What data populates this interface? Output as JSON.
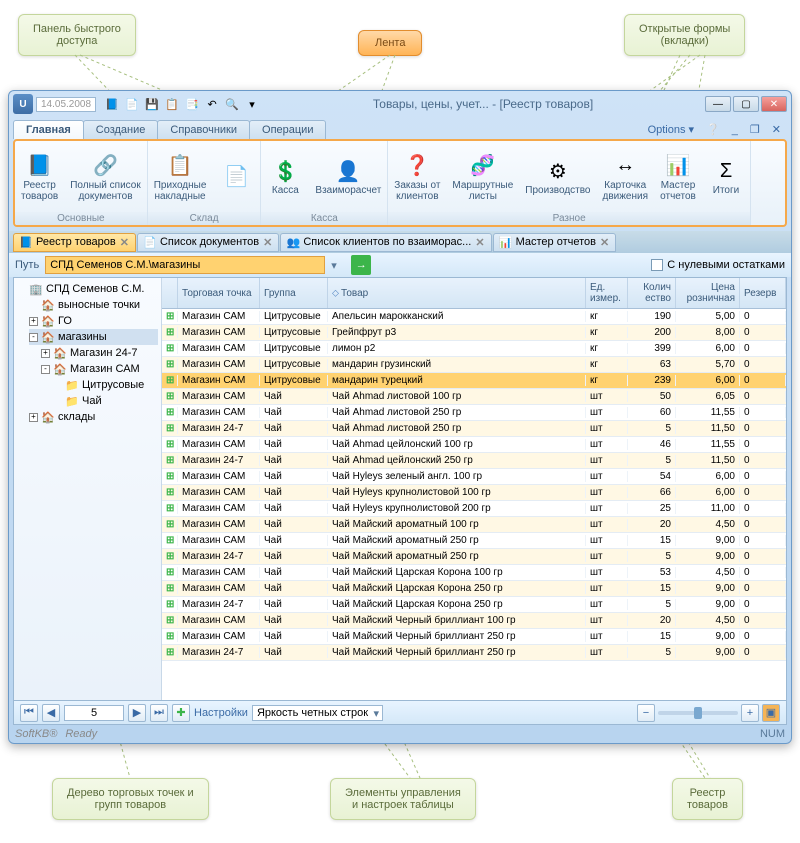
{
  "callouts": {
    "qat": "Панель быстрого\nдоступа",
    "ribbon": "Лента",
    "tabs": "Открытые формы\n(вкладки)",
    "tree": "Дерево торговых точек и\nгрупп товаров",
    "controls": "Элементы управления\nи настроек таблицы",
    "registry": "Реестр\nтоваров"
  },
  "window": {
    "date": "14.05.2008",
    "title": "Товары, цены, учет... - [Реестр товаров]",
    "options": "Options"
  },
  "ribbonTabs": [
    "Главная",
    "Создание",
    "Справочники",
    "Операции"
  ],
  "ribbon": {
    "groups": [
      {
        "label": "Основные",
        "items": [
          {
            "icon": "📘",
            "label": "Реестр\nтоваров"
          },
          {
            "icon": "🔗",
            "label": "Полный список\nдокументов"
          }
        ]
      },
      {
        "label": "Склад",
        "items": [
          {
            "icon": "📋",
            "label": "Приходные\nнакладные"
          },
          {
            "icon": "📄",
            "label": ""
          }
        ]
      },
      {
        "label": "Касса",
        "items": [
          {
            "icon": "💲",
            "label": "Касса"
          },
          {
            "icon": "👤",
            "label": "Взаиморасчет"
          }
        ]
      },
      {
        "label": "Разное",
        "items": [
          {
            "icon": "❓",
            "label": "Заказы от\nклиентов"
          },
          {
            "icon": "🧬",
            "label": "Маршрутные\nлисты"
          },
          {
            "icon": "⚙",
            "label": "Производство"
          },
          {
            "icon": "↔",
            "label": "Карточка\nдвижения"
          },
          {
            "icon": "📊",
            "label": "Мастер\nотчетов"
          },
          {
            "icon": "Σ",
            "label": "Итоги"
          }
        ]
      }
    ]
  },
  "docTabs": [
    {
      "icon": "📘",
      "label": "Реестр товаров",
      "active": true
    },
    {
      "icon": "📄",
      "label": "Список документов",
      "active": false
    },
    {
      "icon": "👥",
      "label": "Список клиентов по взаиморас...",
      "active": false
    },
    {
      "icon": "📊",
      "label": "Мастер отчетов",
      "active": false
    }
  ],
  "pathBar": {
    "label": "Путь",
    "value": "СПД Семенов С.М.\\магазины",
    "checkbox": "С нулевыми остатками"
  },
  "tree": [
    {
      "lvl": 0,
      "exp": "none",
      "icon": "🏢",
      "label": "СПД Семенов С.М."
    },
    {
      "lvl": 1,
      "exp": "none",
      "icon": "🏠",
      "label": "выносные точки"
    },
    {
      "lvl": 1,
      "exp": "+",
      "icon": "🏠",
      "label": "ГО"
    },
    {
      "lvl": 1,
      "exp": "-",
      "icon": "🏠",
      "label": "магазины",
      "sel": true
    },
    {
      "lvl": 2,
      "exp": "+",
      "icon": "🏠",
      "label": "Магазин 24-7"
    },
    {
      "lvl": 2,
      "exp": "-",
      "icon": "🏠",
      "label": "Магазин САМ"
    },
    {
      "lvl": 3,
      "exp": "none",
      "icon": "📁",
      "label": "Цитрусовые"
    },
    {
      "lvl": 3,
      "exp": "none",
      "icon": "📁",
      "label": "Чай"
    },
    {
      "lvl": 1,
      "exp": "+",
      "icon": "🏠",
      "label": "склады"
    }
  ],
  "columns": [
    "",
    "Торговая точка",
    "Группа",
    "Товар",
    "Ед. измер.",
    "Колич ество",
    "Цена розничная",
    "Резерв"
  ],
  "rows": [
    [
      "Магазин САМ",
      "Цитрусовые",
      "Апельсин марокканский",
      "кг",
      "190",
      "5,00",
      "0"
    ],
    [
      "Магазин САМ",
      "Цитрусовые",
      "Грейпфрут р3",
      "кг",
      "200",
      "8,00",
      "0"
    ],
    [
      "Магазин САМ",
      "Цитрусовые",
      "лимон р2",
      "кг",
      "399",
      "6,00",
      "0"
    ],
    [
      "Магазин САМ",
      "Цитрусовые",
      "мандарин грузинский",
      "кг",
      "63",
      "5,70",
      "0"
    ],
    [
      "Магазин САМ",
      "Цитрусовые",
      "мандарин турецкий",
      "кг",
      "239",
      "6,00",
      "0"
    ],
    [
      "Магазин САМ",
      "Чай",
      "Чай Ahmad листовой 100 гр",
      "шт",
      "50",
      "6,05",
      "0"
    ],
    [
      "Магазин САМ",
      "Чай",
      "Чай Ahmad листовой 250 гр",
      "шт",
      "60",
      "11,55",
      "0"
    ],
    [
      "Магазин 24-7",
      "Чай",
      "Чай Ahmad листовой 250 гр",
      "шт",
      "5",
      "11,50",
      "0"
    ],
    [
      "Магазин САМ",
      "Чай",
      "Чай Ahmad цейлонский 100 гр",
      "шт",
      "46",
      "11,55",
      "0"
    ],
    [
      "Магазин 24-7",
      "Чай",
      "Чай Ahmad цейлонский 250 гр",
      "шт",
      "5",
      "11,50",
      "0"
    ],
    [
      "Магазин САМ",
      "Чай",
      "Чай Hyleys зеленый англ. 100 гр",
      "шт",
      "54",
      "6,00",
      "0"
    ],
    [
      "Магазин САМ",
      "Чай",
      "Чай Hyleys крупнолистовой 100 гр",
      "шт",
      "66",
      "6,00",
      "0"
    ],
    [
      "Магазин САМ",
      "Чай",
      "Чай Hyleys крупнолистовой 200 гр",
      "шт",
      "25",
      "11,00",
      "0"
    ],
    [
      "Магазин САМ",
      "Чай",
      "Чай Майский ароматный 100 гр",
      "шт",
      "20",
      "4,50",
      "0"
    ],
    [
      "Магазин САМ",
      "Чай",
      "Чай Майский ароматный 250 гр",
      "шт",
      "15",
      "9,00",
      "0"
    ],
    [
      "Магазин 24-7",
      "Чай",
      "Чай Майский ароматный 250 гр",
      "шт",
      "5",
      "9,00",
      "0"
    ],
    [
      "Магазин САМ",
      "Чай",
      "Чай Майский Царская Корона 100 гр",
      "шт",
      "53",
      "4,50",
      "0"
    ],
    [
      "Магазин САМ",
      "Чай",
      "Чай Майский Царская Корона 250 гр",
      "шт",
      "15",
      "9,00",
      "0"
    ],
    [
      "Магазин 24-7",
      "Чай",
      "Чай Майский Царская Корона 250 гр",
      "шт",
      "5",
      "9,00",
      "0"
    ],
    [
      "Магазин САМ",
      "Чай",
      "Чай Майский Черный бриллиант 100 гр",
      "шт",
      "20",
      "4,50",
      "0"
    ],
    [
      "Магазин САМ",
      "Чай",
      "Чай Майский Черный бриллиант 250 гр",
      "шт",
      "15",
      "9,00",
      "0"
    ],
    [
      "Магазин 24-7",
      "Чай",
      "Чай Майский Черный бриллиант 250 гр",
      "шт",
      "5",
      "9,00",
      "0"
    ]
  ],
  "selectedRow": 4,
  "pager": {
    "page": "5",
    "settings": "Настройки",
    "brightness": "Яркость четных строк"
  },
  "status": {
    "vendor": "SoftKB®",
    "ready": "Ready",
    "num": "NUM"
  }
}
